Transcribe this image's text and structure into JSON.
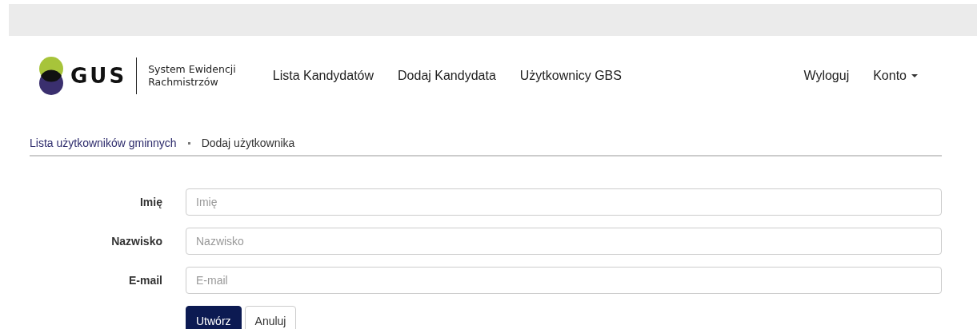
{
  "logo": {
    "text": "GUS",
    "subtitle_lines": [
      "System Ewidencji",
      "Rachmistrzów"
    ]
  },
  "nav": {
    "items": [
      {
        "label": "Lista Kandydatów"
      },
      {
        "label": "Dodaj Kandydata"
      },
      {
        "label": "Użytkownicy GBS"
      }
    ],
    "right": [
      {
        "label": "Wyloguj",
        "dropdown": false
      },
      {
        "label": "Konto",
        "dropdown": true
      }
    ]
  },
  "breadcrumb": [
    {
      "label": "Lista użytkowników gminnych",
      "link": true
    },
    {
      "label": "Dodaj użytkownika",
      "link": false
    }
  ],
  "form": {
    "fields": [
      {
        "label": "Imię",
        "placeholder": "Imię"
      },
      {
        "label": "Nazwisko",
        "placeholder": "Nazwisko"
      },
      {
        "label": "E-mail",
        "placeholder": "E-mail"
      }
    ],
    "buttons": [
      {
        "label": "Utwórz",
        "kind": "primary"
      },
      {
        "label": "Anuluj",
        "kind": "default"
      }
    ]
  }
}
